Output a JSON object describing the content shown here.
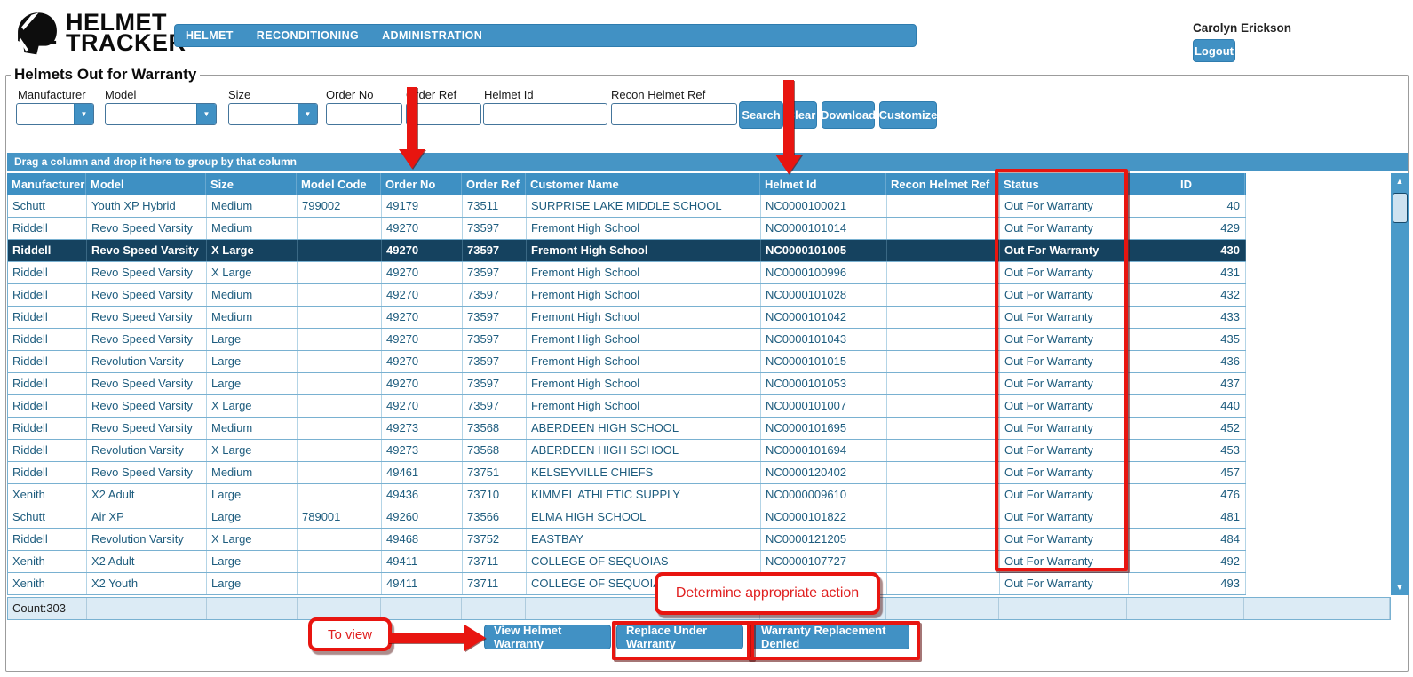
{
  "app": {
    "logo_line1": "HELMET",
    "logo_line2": "TRACKER",
    "nav_items": [
      {
        "label": "HELMET"
      },
      {
        "label": "RECONDITIONING"
      },
      {
        "label": "ADMINISTRATION"
      }
    ],
    "user_name": "Carolyn Erickson",
    "logout_label": "Logout"
  },
  "page": {
    "title": "Helmets Out for Warranty"
  },
  "filters": {
    "dropdowns": [
      {
        "label": "Manufacturer",
        "value": ""
      },
      {
        "label": "Model",
        "value": ""
      },
      {
        "label": "Size",
        "value": ""
      }
    ],
    "inputs": [
      {
        "label": "Order No",
        "value": ""
      },
      {
        "label": "Order Ref",
        "value": ""
      },
      {
        "label": "Helmet Id",
        "value": ""
      },
      {
        "label": "Recon Helmet Ref",
        "value": ""
      }
    ],
    "buttons": [
      {
        "label": "Search"
      },
      {
        "label": "Clear"
      },
      {
        "label": "Download"
      },
      {
        "label": "Customize"
      }
    ]
  },
  "grid": {
    "group_hint": "Drag a column and drop it here to group by that column",
    "columns": [
      {
        "label": "Manufacturer"
      },
      {
        "label": "Model"
      },
      {
        "label": "Size"
      },
      {
        "label": "Model Code"
      },
      {
        "label": "Order No"
      },
      {
        "label": "Order Ref"
      },
      {
        "label": "Customer Name"
      },
      {
        "label": "Helmet Id"
      },
      {
        "label": "Recon Helmet Ref"
      },
      {
        "label": "Status"
      },
      {
        "label": "ID"
      }
    ],
    "rows": [
      {
        "cells": [
          "Schutt",
          "Youth XP Hybrid",
          "Medium",
          "799002",
          "49179",
          "73511",
          "SURPRISE LAKE MIDDLE SCHOOL",
          "NC0000100021",
          "",
          "Out For Warranty",
          "40"
        ],
        "selected": false
      },
      {
        "cells": [
          "Riddell",
          "Revo Speed Varsity",
          "Medium",
          "",
          "49270",
          "73597",
          "Fremont High School",
          "NC0000101014",
          "",
          "Out For Warranty",
          "429"
        ],
        "selected": false
      },
      {
        "cells": [
          "Riddell",
          "Revo Speed Varsity",
          "X Large",
          "",
          "49270",
          "73597",
          "Fremont High School",
          "NC0000101005",
          "",
          "Out For Warranty",
          "430"
        ],
        "selected": true
      },
      {
        "cells": [
          "Riddell",
          "Revo Speed Varsity",
          "X Large",
          "",
          "49270",
          "73597",
          "Fremont High School",
          "NC0000100996",
          "",
          "Out For Warranty",
          "431"
        ],
        "selected": false
      },
      {
        "cells": [
          "Riddell",
          "Revo Speed Varsity",
          "Medium",
          "",
          "49270",
          "73597",
          "Fremont High School",
          "NC0000101028",
          "",
          "Out For Warranty",
          "432"
        ],
        "selected": false
      },
      {
        "cells": [
          "Riddell",
          "Revo Speed Varsity",
          "Medium",
          "",
          "49270",
          "73597",
          "Fremont High School",
          "NC0000101042",
          "",
          "Out For Warranty",
          "433"
        ],
        "selected": false
      },
      {
        "cells": [
          "Riddell",
          "Revo Speed Varsity",
          "Large",
          "",
          "49270",
          "73597",
          "Fremont High School",
          "NC0000101043",
          "",
          "Out For Warranty",
          "435"
        ],
        "selected": false
      },
      {
        "cells": [
          "Riddell",
          "Revolution Varsity",
          "Large",
          "",
          "49270",
          "73597",
          "Fremont High School",
          "NC0000101015",
          "",
          "Out For Warranty",
          "436"
        ],
        "selected": false
      },
      {
        "cells": [
          "Riddell",
          "Revo Speed Varsity",
          "Large",
          "",
          "49270",
          "73597",
          "Fremont High School",
          "NC0000101053",
          "",
          "Out For Warranty",
          "437"
        ],
        "selected": false
      },
      {
        "cells": [
          "Riddell",
          "Revo Speed Varsity",
          "X Large",
          "",
          "49270",
          "73597",
          "Fremont High School",
          "NC0000101007",
          "",
          "Out For Warranty",
          "440"
        ],
        "selected": false
      },
      {
        "cells": [
          "Riddell",
          "Revo Speed Varsity",
          "Medium",
          "",
          "49273",
          "73568",
          "ABERDEEN HIGH SCHOOL",
          "NC0000101695",
          "",
          "Out For Warranty",
          "452"
        ],
        "selected": false
      },
      {
        "cells": [
          "Riddell",
          "Revolution Varsity",
          "X Large",
          "",
          "49273",
          "73568",
          "ABERDEEN HIGH SCHOOL",
          "NC0000101694",
          "",
          "Out For Warranty",
          "453"
        ],
        "selected": false
      },
      {
        "cells": [
          "Riddell",
          "Revo Speed Varsity",
          "Medium",
          "",
          "49461",
          "73751",
          "KELSEYVILLE CHIEFS",
          "NC0000120402",
          "",
          "Out For Warranty",
          "457"
        ],
        "selected": false
      },
      {
        "cells": [
          "Xenith",
          "X2 Adult",
          "Large",
          "",
          "49436",
          "73710",
          "KIMMEL ATHLETIC SUPPLY",
          "NC0000009610",
          "",
          "Out For Warranty",
          "476"
        ],
        "selected": false
      },
      {
        "cells": [
          "Schutt",
          "Air XP",
          "Large",
          "789001",
          "49260",
          "73566",
          "ELMA HIGH SCHOOL",
          "NC0000101822",
          "",
          "Out For Warranty",
          "481"
        ],
        "selected": false
      },
      {
        "cells": [
          "Riddell",
          "Revolution Varsity",
          "X Large",
          "",
          "49468",
          "73752",
          "EASTBAY",
          "NC0000121205",
          "",
          "Out For Warranty",
          "484"
        ],
        "selected": false
      },
      {
        "cells": [
          "Xenith",
          "X2 Adult",
          "Large",
          "",
          "49411",
          "73711",
          "COLLEGE OF SEQUOIAS",
          "NC0000107727",
          "",
          "Out For Warranty",
          "492"
        ],
        "selected": false
      },
      {
        "cells": [
          "Xenith",
          "X2 Youth",
          "Large",
          "",
          "49411",
          "73711",
          "COLLEGE OF SEQUOIAS",
          "",
          "",
          "Out For Warranty",
          "493"
        ],
        "selected": false
      }
    ],
    "footer": {
      "count_label": "Count:303"
    }
  },
  "actions": [
    {
      "label": "View Helmet Warranty"
    },
    {
      "label": "Replace Under Warranty"
    },
    {
      "label": "Warranty Replacement Denied"
    }
  ],
  "annotations": {
    "determine_text": "Determine appropriate action",
    "to_view_text": "To view"
  },
  "colors": {
    "accent_blue": "#4191c4",
    "header_blue": "#3e90c3",
    "selected_row": "#15425f",
    "annotation_red": "#e81510"
  }
}
